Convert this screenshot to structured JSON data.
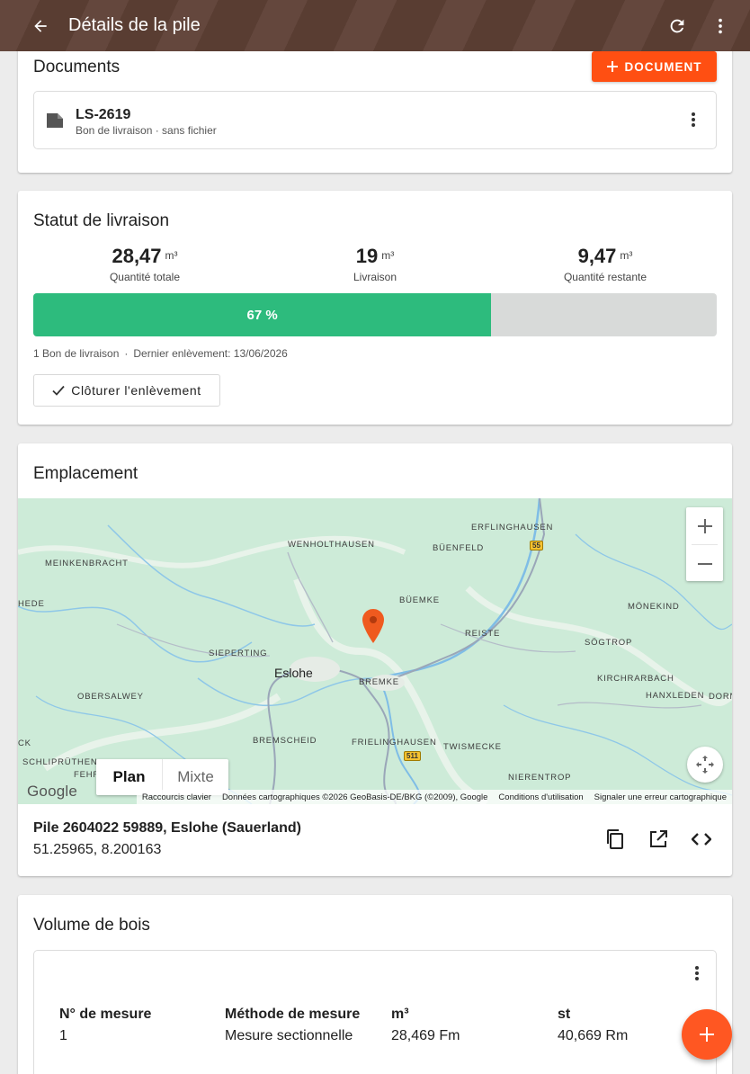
{
  "appbar": {
    "title": "Détails de la pile"
  },
  "documents": {
    "title": "Documents",
    "add_label": "DOCUMENT",
    "items": [
      {
        "name": "LS-2619",
        "subtitle": "Bon de livraison · sans fichier"
      }
    ]
  },
  "status": {
    "title": "Statut de livraison",
    "stats": [
      {
        "value": "28,47",
        "unit": "m³",
        "label": "Quantité totale"
      },
      {
        "value": "19",
        "unit": "m³",
        "label": "Livraison"
      },
      {
        "value": "9,47",
        "unit": "m³",
        "label": "Quantité restante"
      }
    ],
    "progress_percent": 67,
    "progress_label": "67 %",
    "meta_count": "1 Bon de livraison",
    "meta_last": "Dernier enlèvement: 13/06/2026",
    "close_label": "Clôturer l'enlèvement"
  },
  "location": {
    "title": "Emplacement",
    "map": {
      "labels": {
        "wenholthausen": "WENHOLTHAUSEN",
        "erflinghausen": "ERFLINGHAUSEN",
        "buenfeld": "BÜENFELD",
        "meinkenbracht": "MEINKENBRACHT",
        "hede": "HEDE",
        "buemke": "BÜEMKE",
        "monekind": "MÖNEKIND",
        "reiste": "REISTE",
        "soegtrop": "SÖGTROP",
        "sieperting": "SIEPERTING",
        "eslohe": "Eslohe",
        "bremke": "BREMKE",
        "kirchrarbach": "KIRCHRARBACH",
        "obersalwey": "OBERSALWEY",
        "hanxleden": "HANXLEDEN",
        "dorn": "DORN",
        "ck": "CK",
        "bremscheid": "BREMSCHEID",
        "frielinghausen": "FRIELINGHAUSEN",
        "twismecke": "TWISMECKE",
        "schlipruethen": "SCHLIPRÜTHEN",
        "fehr": "FEHR",
        "nierentrop": "NIERENTROP"
      },
      "road_55": "55",
      "road_511": "511",
      "type_plan": "Plan",
      "type_mixte": "Mixte",
      "google": "Google",
      "attrib_shortcuts": "Raccourcis clavier",
      "attrib_data": "Données cartographiques ©2026 GeoBasis-DE/BKG (©2009), Google",
      "attrib_terms": "Conditions d'utilisation",
      "attrib_report": "Signaler une erreur cartographique"
    },
    "name": "Pile 2604022 59889, Eslohe (Sauerland)",
    "coords": "51.25965, 8.200163"
  },
  "volume": {
    "title": "Volume de bois",
    "columns": [
      {
        "header": "N° de mesure",
        "value": "1"
      },
      {
        "header": "Méthode de mesure",
        "value": "Mesure sectionnelle"
      },
      {
        "header": "m³",
        "value": "28,469 Fm"
      },
      {
        "header": "st",
        "value": "40,669 Rm"
      }
    ]
  },
  "colors": {
    "appbar": "#5e4035",
    "accent": "#ff4f12",
    "progress": "#2dbb7d",
    "fab": "#ff5722"
  }
}
